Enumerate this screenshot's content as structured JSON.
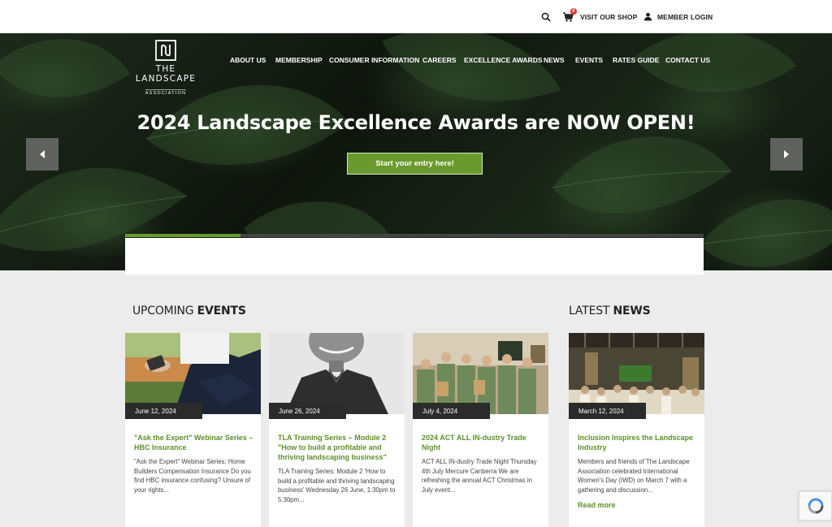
{
  "topbar": {
    "shop_label": "VISIT OUR SHOP",
    "login_label": "MEMBER LOGIN",
    "cart_count": "0"
  },
  "logo": {
    "title": "THE LANDSCAPE",
    "subtitle": "ASSOCIATION"
  },
  "nav": {
    "items": [
      {
        "label": "ABOUT US"
      },
      {
        "label": "MEMBERSHIP"
      },
      {
        "label": "CONSUMER INFORMATION"
      },
      {
        "label": "CAREERS"
      },
      {
        "label": "EXCELLENCE AWARDS"
      },
      {
        "label": "NEWS"
      },
      {
        "label": "EVENTS"
      },
      {
        "label": "RATES GUIDE"
      },
      {
        "label": "CONTACT US"
      }
    ]
  },
  "hero": {
    "title": "2024 Landscape Excellence Awards are NOW OPEN!",
    "cta_label": "Start your entry here!",
    "slide_progress": 0.2
  },
  "events_section": {
    "heading_light": "UPCOMING ",
    "heading_bold": "EVENTS"
  },
  "news_section": {
    "heading_light": "LATEST ",
    "heading_bold": "NEWS"
  },
  "events": [
    {
      "date": "June 12, 2024",
      "title": "\"Ask the Expert\" Webinar Series – HBC Insurance",
      "excerpt": "\"Ask the Expert\" Webinar Series: Home Builders Compensation Insurance   Do you find HBC insurance confusing? Unsure of your rights..."
    },
    {
      "date": "June 26, 2024",
      "title": "TLA Training Series – Module 2 \"How to build a profitable and thriving landscaping business\"",
      "excerpt": "TLA Training Series: Module 2 'How to build a profitable and thriving landscaping business' Wednesday 26 June, 1:30pm to 5:30pm..."
    },
    {
      "date": "July 4, 2024",
      "title": "2024 ACT ALL IN-dustry Trade Night",
      "excerpt": "ACT ALL IN-dustry Trade Night Thursday 4th July Mercure Canberra We are refreshing the annual ACT Christmas in July event..."
    }
  ],
  "news": [
    {
      "date": "March 12, 2024",
      "title": "Inclusion Inspires the Landscape Industry",
      "excerpt": "Members and friends of The Landscape Association celebrated International Women's Day (IWD) on March 7 with a gathering and discussion...",
      "read_more": "Read more"
    }
  ],
  "colors": {
    "accent_green": "#6a9a2e",
    "link_green": "#5f8f2a",
    "dark": "#2b2b2b"
  },
  "icons": [
    "search-icon",
    "cart-icon",
    "user-icon",
    "logo-mark-icon",
    "chevron-left-icon",
    "chevron-right-icon",
    "recaptcha-icon"
  ]
}
